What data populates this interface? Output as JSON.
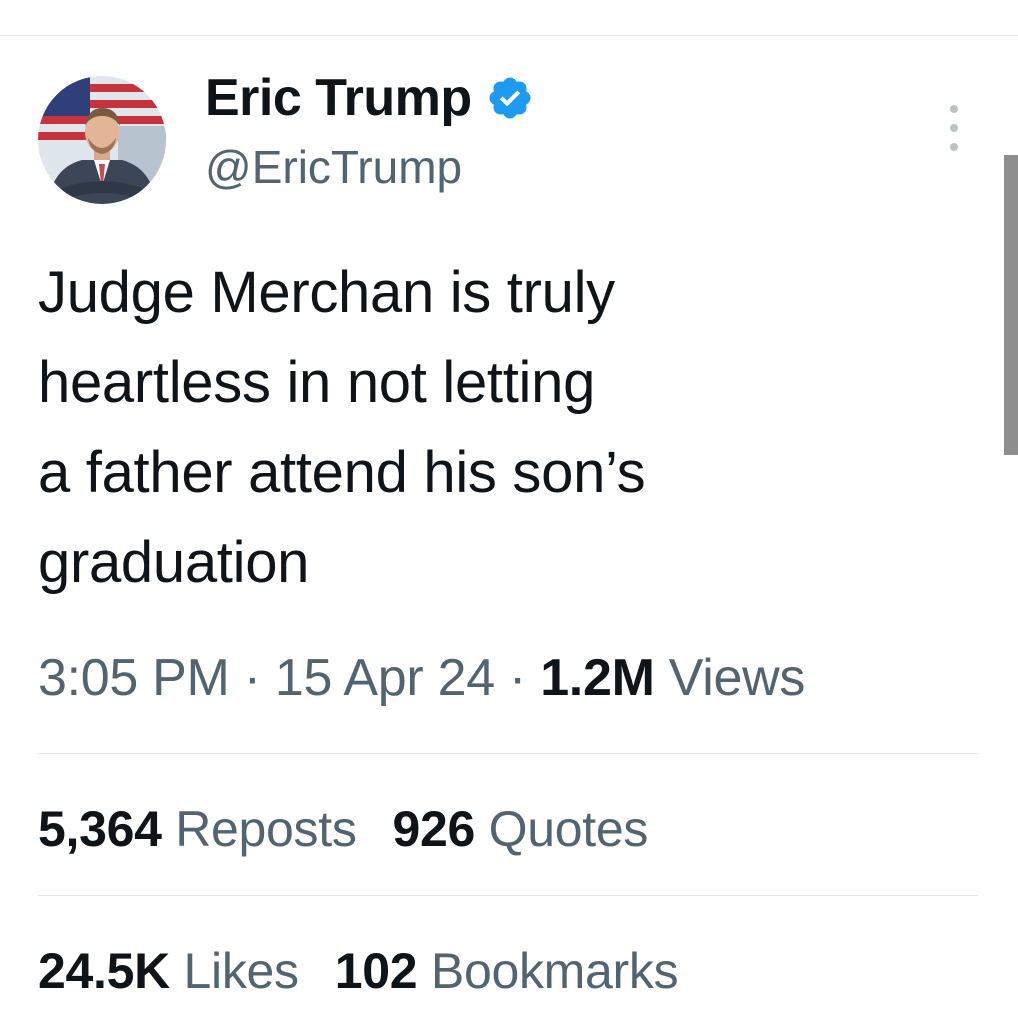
{
  "author": {
    "display_name": "Eric Trump",
    "handle": "@EricTrump",
    "verified_icon": "verified-badge-icon",
    "accent_color": "#1d9bf0"
  },
  "tweet": {
    "lines": [
      "Judge Merchan is truly",
      "heartless in not letting",
      "a father attend his son’s",
      "graduation"
    ]
  },
  "meta": {
    "time": "3:05 PM",
    "date": "15 Apr 24",
    "views_count": "1.2M",
    "views_label": "Views",
    "separator": "·"
  },
  "stats": {
    "reposts": {
      "count": "5,364",
      "label": "Reposts"
    },
    "quotes": {
      "count": "926",
      "label": "Quotes"
    },
    "likes": {
      "count": "24.5K",
      "label": "Likes"
    },
    "bookmarks": {
      "count": "102",
      "label": "Bookmarks"
    }
  },
  "colors": {
    "text_primary": "#0f1419",
    "text_secondary": "#536471"
  }
}
